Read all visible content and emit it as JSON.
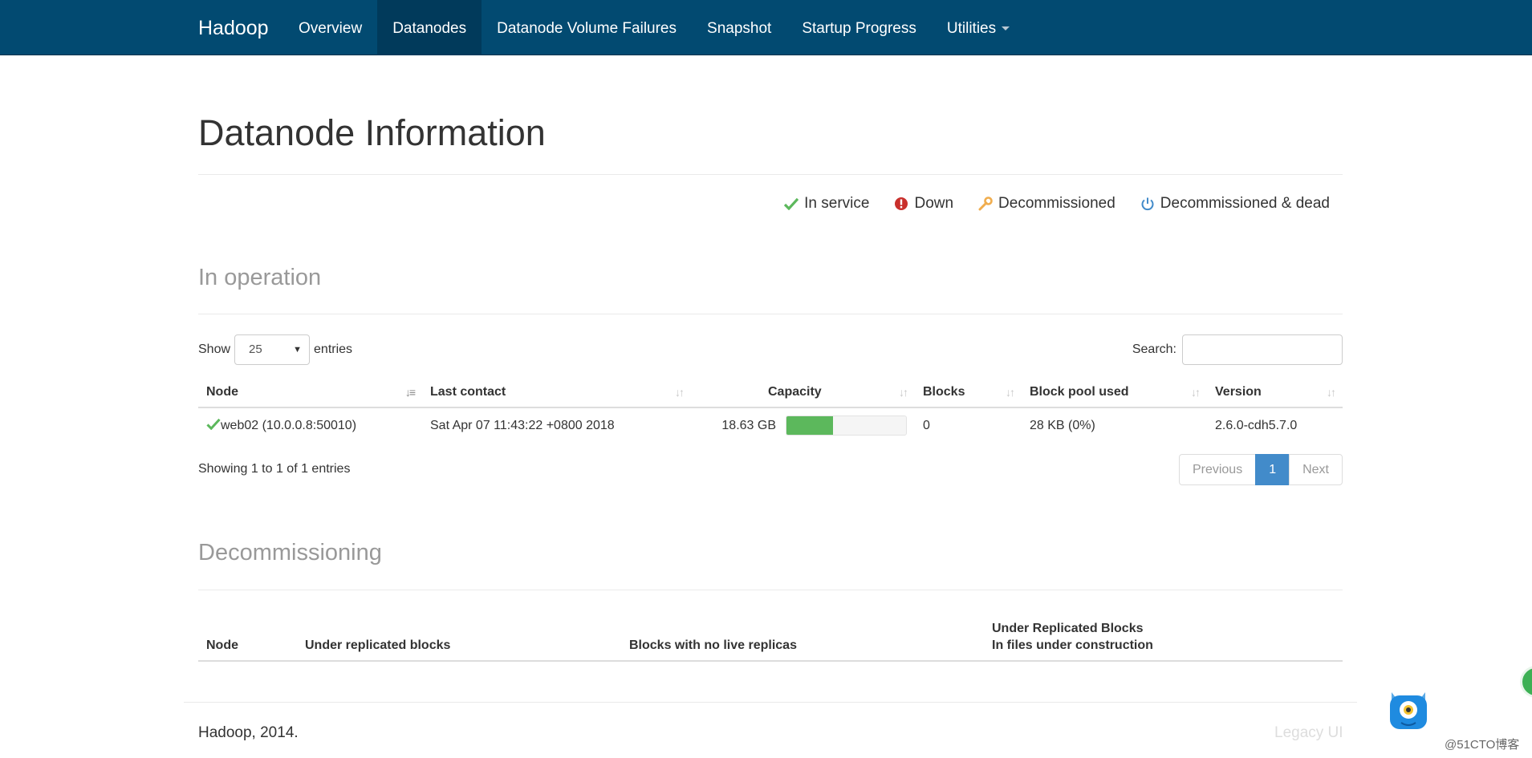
{
  "navbar": {
    "brand": "Hadoop",
    "items": [
      {
        "label": "Overview"
      },
      {
        "label": "Datanodes",
        "active": true
      },
      {
        "label": "Datanode Volume Failures"
      },
      {
        "label": "Snapshot"
      },
      {
        "label": "Startup Progress"
      },
      {
        "label": "Utilities"
      }
    ]
  },
  "page": {
    "title": "Datanode Information"
  },
  "legend": [
    {
      "label": "In service",
      "icon": "check-icon",
      "color": "#5cb85c"
    },
    {
      "label": "Down",
      "icon": "exclamation-circle-icon",
      "color": "#d9534f"
    },
    {
      "label": "Decommissioned",
      "icon": "wrench-icon",
      "color": "#f0ad4e"
    },
    {
      "label": "Decommissioned & dead",
      "icon": "power-icon",
      "color": "#428bca"
    }
  ],
  "in_operation": {
    "heading": "In operation",
    "show_label": "Show",
    "entries_value": "25",
    "entries_label": "entries",
    "search_label": "Search:",
    "search_value": "",
    "columns": [
      "Node",
      "Last contact",
      "Capacity",
      "Blocks",
      "Block pool used",
      "Version"
    ],
    "rows": [
      {
        "node": "web02 (10.0.0.8:50010)",
        "last_contact": "Sat Apr 07 11:43:22 +0800 2018",
        "capacity": "18.63 GB",
        "capacity_used_percent": 39,
        "blocks": "0",
        "block_pool_used": "28 KB (0%)",
        "version": "2.6.0-cdh5.7.0"
      }
    ],
    "info": "Showing 1 to 1 of 1 entries",
    "pager": {
      "previous": "Previous",
      "page": "1",
      "next": "Next"
    }
  },
  "decommissioning": {
    "heading": "Decommissioning",
    "columns": [
      "Node",
      "Under replicated blocks",
      "Blocks with no live replicas",
      "Under Replicated Blocks",
      "In files under construction"
    ]
  },
  "footer": {
    "left": "Hadoop, 2014.",
    "right": "Legacy UI"
  },
  "watermark": "@51CTO博客",
  "colors": {
    "navbar": "#024a71",
    "navbar_active": "#013a5b",
    "progress": "#5cb85c",
    "pager_active": "#428bca"
  }
}
